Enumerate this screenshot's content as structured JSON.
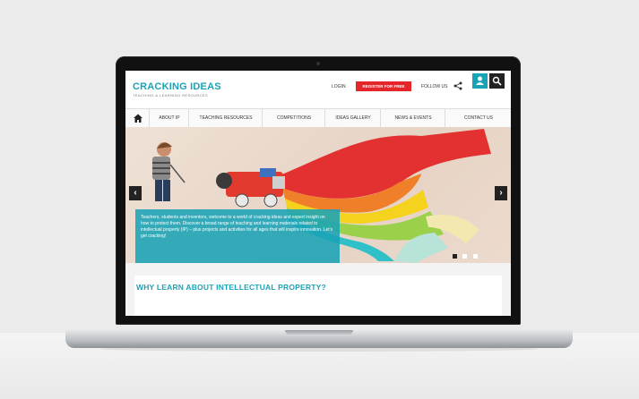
{
  "site": {
    "logo_title": "CRACKING IDEAS",
    "logo_subtitle": "TEACHING & LEARNING RESOURCES",
    "login": "LOGIN",
    "register": "REGISTER FOR FREE",
    "follow": "FOLLOW US",
    "icons": {
      "share": "share-icon",
      "user": "user-icon",
      "search": "search-icon",
      "home": "home-icon"
    }
  },
  "nav": {
    "items": [
      "ABOUT IP",
      "TEACHING RESOURCES",
      "COMPETITIONS",
      "IDEAS GALLERY",
      "NEWS & EVENTS",
      "CONTACT US"
    ]
  },
  "hero": {
    "prev": "‹",
    "next": "›",
    "caption": "Teachers, students and inventors, welcome to a world of cracking ideas and expert insight on how to protect them. Discover a broad range of teaching and learning materials related to intellectual property (IP) – plus projects and activities for all ages that will inspire innovation. Let's get cracking!",
    "slides": {
      "total": 3,
      "active": 1
    }
  },
  "section": {
    "title": "WHY LEARN ABOUT INTELLECTUAL PROPERTY?"
  },
  "colors": {
    "brand": "#1aa3b6",
    "register": "#e4262b",
    "dark": "#222222"
  }
}
